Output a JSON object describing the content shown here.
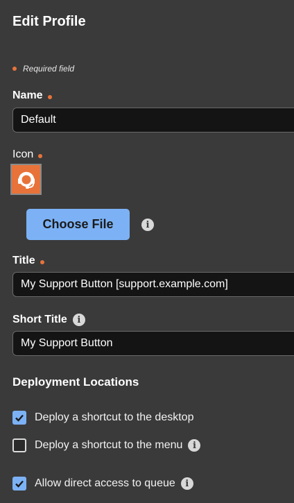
{
  "page": {
    "title": "Edit Profile",
    "required_note": "Required field"
  },
  "fields": {
    "name": {
      "label": "Name",
      "value": "Default"
    },
    "icon": {
      "label": "Icon",
      "image": "headset-icon",
      "choose_label": "Choose File"
    },
    "title": {
      "label": "Title",
      "value": "My Support Button [support.example.com]"
    },
    "short_title": {
      "label": "Short Title",
      "value": "My Support Button"
    }
  },
  "deployment": {
    "title": "Deployment Locations",
    "options": [
      {
        "label": "Deploy a shortcut to the desktop",
        "checked": true,
        "info": false
      },
      {
        "label": "Deploy a shortcut to the menu",
        "checked": false,
        "info": true
      },
      {
        "label": "Allow direct access to queue",
        "checked": true,
        "info": true
      }
    ]
  },
  "colors": {
    "accent": "#7cb2f5",
    "required": "#e8733a",
    "background": "#3a3a3a",
    "input_bg": "#141414"
  }
}
